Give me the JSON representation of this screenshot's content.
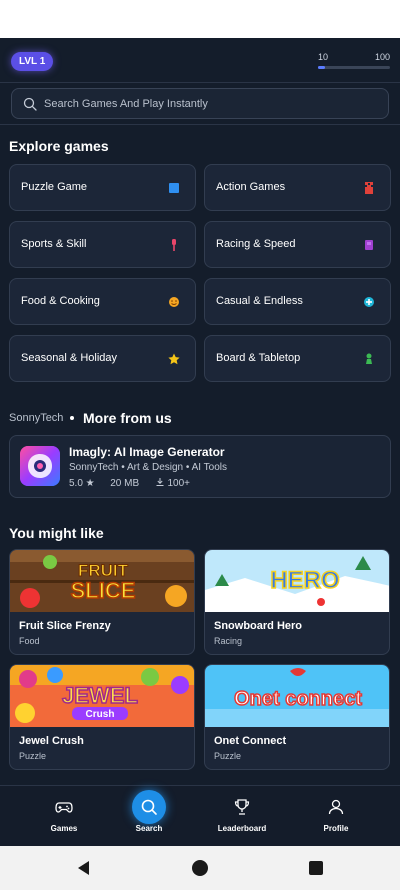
{
  "header": {
    "level_badge": "LVL 1",
    "xp_min": "10",
    "xp_max": "100",
    "xp_progress": 0.1
  },
  "search": {
    "placeholder": "Search Games And Play Instantly"
  },
  "explore": {
    "title": "Explore games",
    "categories": [
      {
        "label": "Puzzle Game",
        "icon": "blue-square-icon",
        "color": "#2f8ff0"
      },
      {
        "label": "Action Games",
        "icon": "red-castle-icon",
        "color": "#e0413a"
      },
      {
        "label": "Sports & Skill",
        "icon": "pin-icon",
        "color": "#e8466a"
      },
      {
        "label": "Racing & Speed",
        "icon": "purple-flag-icon",
        "color": "#a040d0"
      },
      {
        "label": "Food & Cooking",
        "icon": "smiley-food-icon",
        "color": "#f5a623"
      },
      {
        "label": "Casual & Endless",
        "icon": "plus-circle-icon",
        "color": "#1fb6d8"
      },
      {
        "label": "Seasonal & Holiday",
        "icon": "star-icon",
        "color": "#f5c518"
      },
      {
        "label": "Board & Tabletop",
        "icon": "pawn-icon",
        "color": "#3cba54"
      }
    ]
  },
  "developer": {
    "name": "SonnyTech",
    "section_title": "More from us",
    "app": {
      "name": "Imagly: AI Image Generator",
      "meta": "SonnyTech • Art & Design • AI Tools",
      "rating": "5.0 ★",
      "size": "20 MB",
      "downloads": "100+"
    }
  },
  "recommendations": {
    "title": "You might like",
    "games": [
      {
        "title": "Fruit Slice Frenzy",
        "category": "Food",
        "thumb_text": "FRUIT SLICE"
      },
      {
        "title": "Snowboard Hero",
        "category": "Racing",
        "thumb_text": "HERO"
      },
      {
        "title": "Jewel Crush",
        "category": "Puzzle",
        "thumb_text": "JEWEL"
      },
      {
        "title": "Onet Connect",
        "category": "Puzzle",
        "thumb_text": "Onet connect"
      }
    ]
  },
  "bottom_nav": {
    "items": [
      {
        "label": "Games",
        "icon": "gamepad-icon"
      },
      {
        "label": "Search",
        "icon": "search-icon",
        "active": true
      },
      {
        "label": "Leaderboard",
        "icon": "trophy-icon"
      },
      {
        "label": "Profile",
        "icon": "user-icon"
      }
    ]
  },
  "colors": {
    "background": "#141d2b",
    "card": "#1c2638",
    "accent_purple": "#5b4fe6",
    "accent_blue": "#1e8ee6"
  }
}
